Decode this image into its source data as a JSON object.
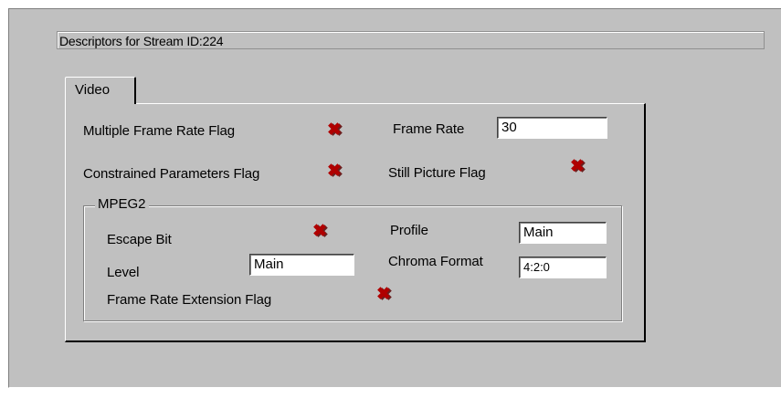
{
  "header": {
    "title": "Descriptors for Stream ID:224"
  },
  "tabs": [
    {
      "label": "Video"
    }
  ],
  "video": {
    "multiple_frame_rate_flag": {
      "label": "Multiple Frame Rate Flag",
      "state": "false",
      "icon": "x-mark-icon"
    },
    "frame_rate": {
      "label": "Frame Rate",
      "value": "30"
    },
    "constrained_parameters_flag": {
      "label": "Constrained Parameters Flag",
      "state": "false",
      "icon": "x-mark-icon"
    },
    "still_picture_flag": {
      "label": "Still Picture Flag",
      "state": "false",
      "icon": "x-mark-icon"
    }
  },
  "mpeg2": {
    "group_label": "MPEG2",
    "escape_bit": {
      "label": "Escape Bit",
      "state": "false",
      "icon": "x-mark-icon"
    },
    "profile": {
      "label": "Profile",
      "value": "Main"
    },
    "level": {
      "label": "Level",
      "value": "Main"
    },
    "chroma_format": {
      "label": "Chroma Format",
      "value": "4:2:0"
    },
    "frame_rate_extension_flag": {
      "label": "Frame Rate Extension Flag",
      "state": "false",
      "icon": "x-mark-icon"
    }
  },
  "colors": {
    "background": "#c0c0c0",
    "x_mark": "#b00000"
  }
}
